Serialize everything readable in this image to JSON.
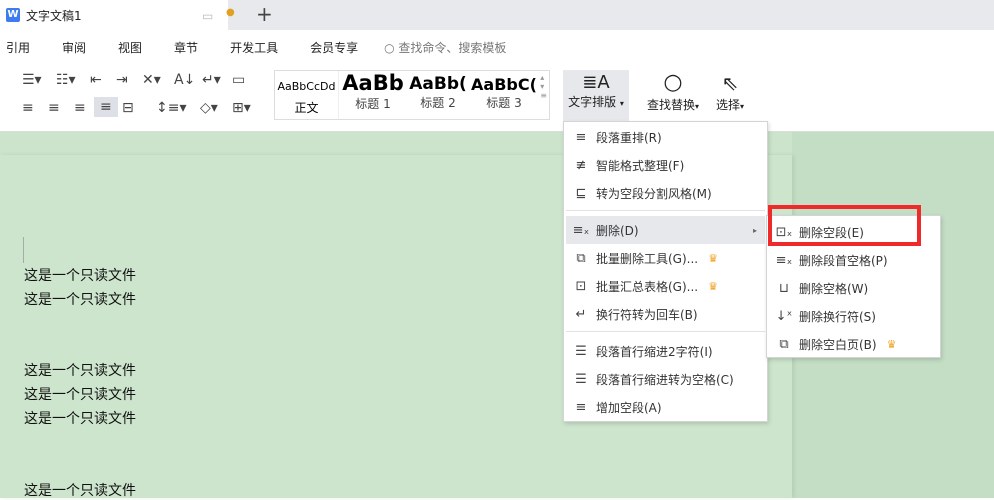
{
  "tab": {
    "title": "文字文稿1",
    "new_tab": "+"
  },
  "menubar": [
    "引用",
    "审阅",
    "视图",
    "章节",
    "开发工具",
    "会员专享"
  ],
  "search_placeholder": "查找命令、搜索模板",
  "styles": [
    {
      "sample": "AaBbCcDd",
      "label": "正文"
    },
    {
      "sample": "AaBb",
      "label": "标题 1"
    },
    {
      "sample": "AaBb(",
      "label": "标题 2"
    },
    {
      "sample": "AaBbC(",
      "label": "标题 3"
    }
  ],
  "ribbon": {
    "text_layout": "文字排版",
    "find_replace": "查找替换",
    "select": "选择"
  },
  "document": {
    "lines": [
      "这是一个只读文件",
      "这是一个只读文件",
      "这是一个只读文件",
      "这是一个只读文件",
      "这是一个只读文件",
      "这是一个只读文件"
    ]
  },
  "menu": {
    "items": [
      {
        "label": "段落重排(R)",
        "icon": "reflow-icon"
      },
      {
        "label": "智能格式整理(F)",
        "icon": "smart-format-icon"
      },
      {
        "label": "转为空段分割风格(M)",
        "icon": "split-style-icon"
      },
      {
        "label": "删除(D)",
        "icon": "delete-lines-icon"
      },
      {
        "label": "批量删除工具(G)...",
        "icon": "batch-delete-icon",
        "vip": true
      },
      {
        "label": "批量汇总表格(G)...",
        "icon": "batch-table-icon",
        "vip": true
      },
      {
        "label": "换行符转为回车(B)",
        "icon": "linebreak-icon"
      },
      {
        "label": "段落首行缩进2字符(I)",
        "icon": "indent-icon"
      },
      {
        "label": "段落首行缩进转为空格(C)",
        "icon": "indent-space-icon"
      },
      {
        "label": "增加空段(A)",
        "icon": "add-paragraph-icon"
      }
    ]
  },
  "submenu": {
    "items": [
      {
        "label": "删除空段(E)"
      },
      {
        "label": "删除段首空格(P)"
      },
      {
        "label": "删除空格(W)"
      },
      {
        "label": "删除换行符(S)"
      },
      {
        "label": "删除空白页(B)",
        "vip": true
      }
    ]
  },
  "colors": {
    "doc_bg": "#cde5cd",
    "highlight": "#ee2a2a",
    "crown": "#f0a020"
  }
}
